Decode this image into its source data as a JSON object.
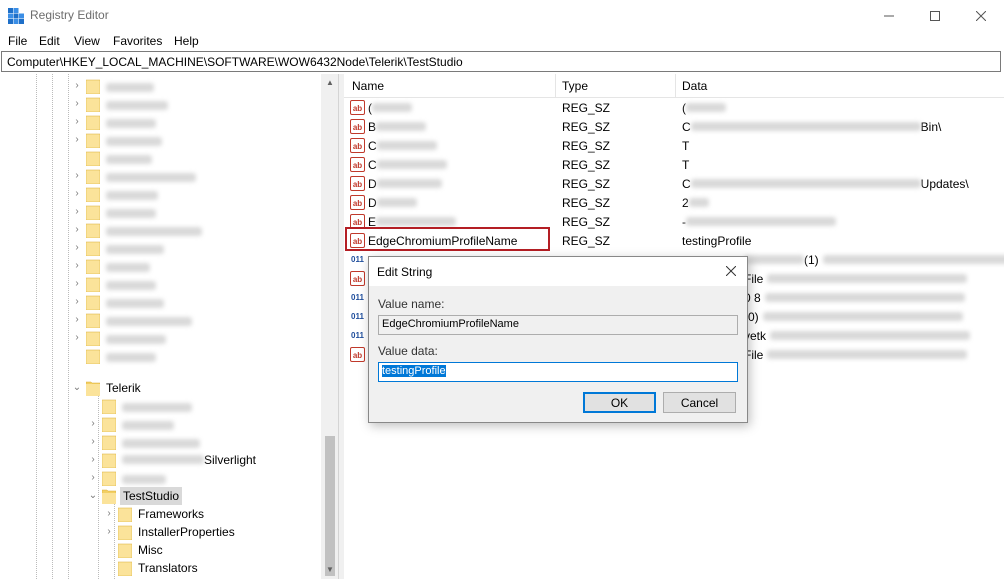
{
  "window": {
    "title": "Registry Editor"
  },
  "menu": [
    "File",
    "Edit",
    "View",
    "Favorites",
    "Help"
  ],
  "address": "Computer\\HKEY_LOCAL_MACHINE\\SOFTWARE\\WOW6432Node\\Telerik\\TestStudio",
  "tree": {
    "telerik_label": "Telerik",
    "silverlight_suffix": "Silverlight",
    "teststudio_label": "TestStudio",
    "children": [
      "Frameworks",
      "InstallerProperties",
      "Misc",
      "Translators"
    ]
  },
  "list": {
    "columns": [
      "Name",
      "Type",
      "Data"
    ],
    "rows": [
      {
        "name": "(",
        "type": "REG_SZ",
        "data": "("
      },
      {
        "name": "B",
        "type": "REG_SZ",
        "data": "C",
        "data_tail": "Bin\\"
      },
      {
        "name": "C",
        "type": "REG_SZ",
        "data": "T"
      },
      {
        "name": "C",
        "type": "REG_SZ",
        "data": "T"
      },
      {
        "name": "D",
        "type": "REG_SZ",
        "data": "C",
        "data_tail": "Updates\\"
      },
      {
        "name": "D",
        "type": "REG_SZ",
        "data": "2"
      },
      {
        "name": "E",
        "type": "REG_SZ",
        "data": "-"
      },
      {
        "name": "EdgeChromiumProfileName",
        "type": "REG_SZ",
        "data": "testingProfile"
      },
      {
        "name": "",
        "type": "",
        "data": "",
        "data_tail": "(1)"
      },
      {
        "name": "",
        "type": "",
        "data": "",
        "data_tail": "File"
      },
      {
        "name": "",
        "type": "",
        "data": "",
        "data_tail": "0 8"
      },
      {
        "name": "",
        "type": "",
        "data": "",
        "data_tail": "(0)"
      },
      {
        "name": "",
        "type": "",
        "data": "",
        "data_tail": "vetk"
      },
      {
        "name": "",
        "type": "",
        "data": "",
        "data_tail": "File"
      }
    ]
  },
  "dialog": {
    "title": "Edit String",
    "value_name_label": "Value name:",
    "value_name": "EdgeChromiumProfileName",
    "value_data_label": "Value data:",
    "value_data": "testingProfile",
    "ok": "OK",
    "cancel": "Cancel"
  }
}
